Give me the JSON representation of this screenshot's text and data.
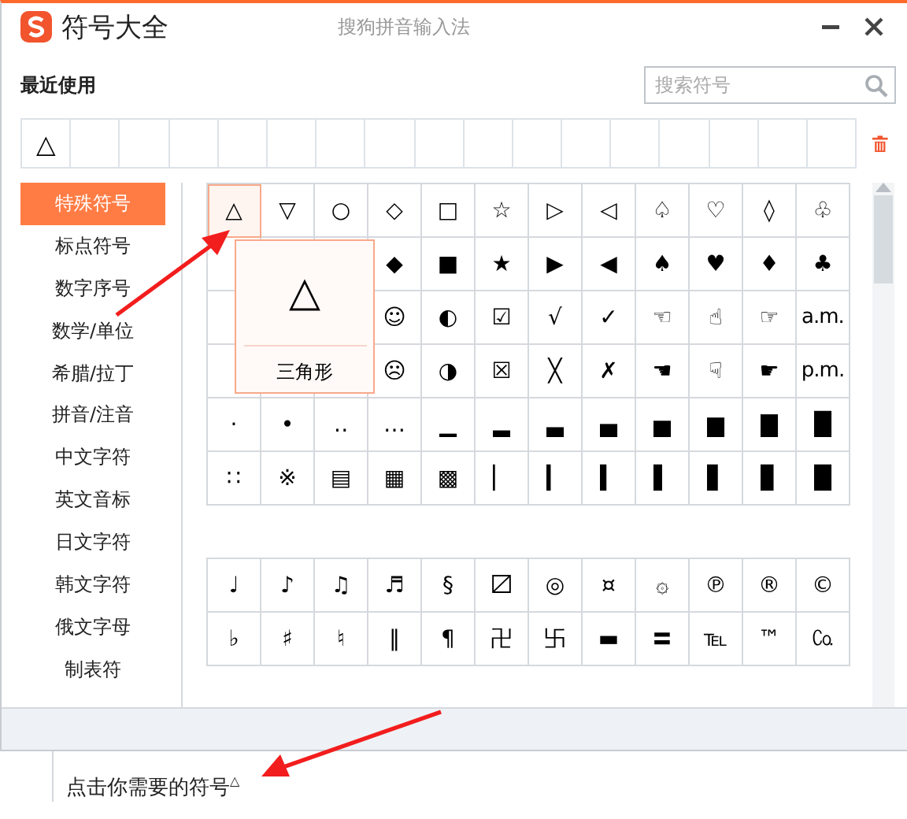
{
  "window": {
    "title": "符号大全",
    "subtitle": "搜狗拼音输入法"
  },
  "recent": {
    "label": "最近使用",
    "search_placeholder": "搜索符号",
    "cells": [
      {
        "symbol": "△"
      },
      {},
      {},
      {},
      {},
      {},
      {},
      {},
      {},
      {},
      {},
      {},
      {},
      {},
      {},
      {},
      {}
    ]
  },
  "sidebar": {
    "items": [
      {
        "label": "特殊符号",
        "selected": true
      },
      {
        "label": "标点符号",
        "selected": false
      },
      {
        "label": "数字序号",
        "selected": false
      },
      {
        "label": "数学/单位",
        "selected": false
      },
      {
        "label": "希腊/拉丁",
        "selected": false
      },
      {
        "label": "拼音/注音",
        "selected": false
      },
      {
        "label": "中文字符",
        "selected": false
      },
      {
        "label": "英文音标",
        "selected": false
      },
      {
        "label": "日文字符",
        "selected": false
      },
      {
        "label": "韩文字符",
        "selected": false
      },
      {
        "label": "俄文字母",
        "selected": false
      },
      {
        "label": "制表符",
        "selected": false
      }
    ]
  },
  "grids": [
    {
      "rows": [
        [
          "△",
          "▽",
          "○",
          "◇",
          "□",
          "☆",
          "▷",
          "◁",
          "♤",
          "♡",
          "◊",
          "♧"
        ],
        [
          "",
          "",
          "",
          "◆",
          "■",
          "★",
          "▶",
          "◀",
          "♠",
          "♥",
          "♦",
          "♣"
        ],
        [
          "",
          "",
          "",
          "☺",
          "◐",
          "☑",
          "√",
          "✓",
          "☜",
          "☝",
          "☞",
          "a.m."
        ],
        [
          "",
          "",
          "",
          "☹",
          "◑",
          "☒",
          "╳",
          "✗",
          "☚",
          "☟",
          "☛",
          "p.m."
        ],
        [
          "·",
          "•",
          "‥",
          "…",
          "▁",
          "▂",
          "▃",
          "▄",
          "▅",
          "▆",
          "▇",
          "█"
        ],
        [
          "∷",
          "※",
          "▤",
          "▦",
          "▩",
          "▏",
          "▎",
          "▍",
          "▌",
          "▋",
          "▊",
          "█"
        ]
      ]
    },
    {
      "rows": [
        [
          "♩",
          "♪",
          "♫",
          "♬",
          "§",
          "〼",
          "◎",
          "¤",
          "۞",
          "℗",
          "®",
          "©"
        ],
        [
          "♭",
          "♯",
          "♮",
          "‖",
          "¶",
          "卍",
          "卐",
          "▬",
          "〓",
          "℡",
          "™",
          "㏇"
        ]
      ]
    }
  ],
  "tooltip": {
    "symbol": "△",
    "name": "三角形"
  },
  "document": {
    "text": "点击你需要的符号$^{△}$"
  }
}
